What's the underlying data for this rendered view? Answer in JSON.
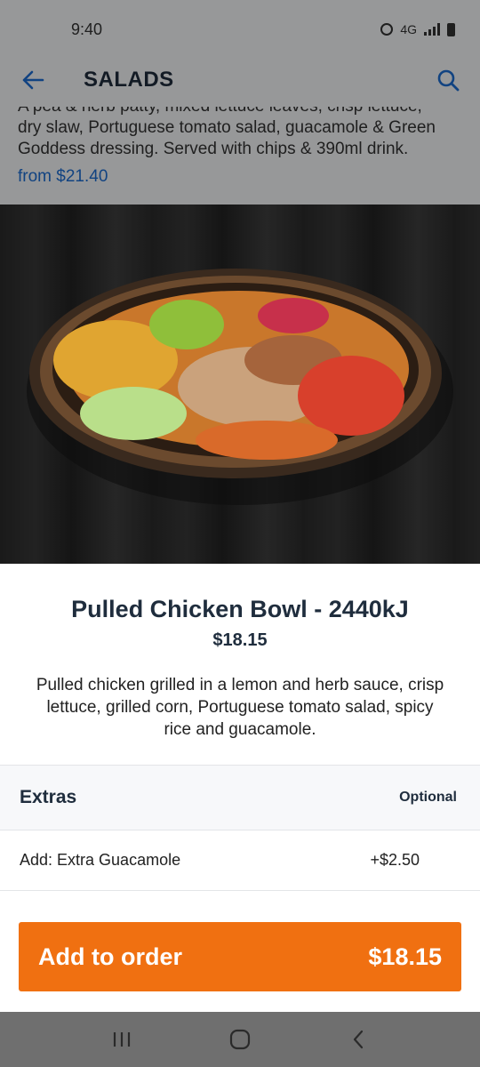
{
  "status_bar": {
    "time": "9:40",
    "network": "4G"
  },
  "app_bar": {
    "title": "SALADS"
  },
  "background_item": {
    "description_lines": [
      "A pea & herb patty, mixed lettuce leaves, crisp lettuce,",
      "dry slaw, Portuguese tomato salad, guacamole & Green",
      "Goddess dressing. Served with chips & 390ml drink."
    ],
    "price": "from $21.40"
  },
  "item": {
    "title": "Pulled Chicken Bowl - 2440kJ",
    "price": "$18.15",
    "description_lines": [
      "Pulled chicken grilled in a lemon and herb sauce, crisp",
      "lettuce, grilled corn, Portuguese tomato salad, spicy",
      "rice and guacamole."
    ]
  },
  "extras": {
    "title": "Extras",
    "optional_label": "Optional",
    "options": [
      {
        "label": "Add: Extra Guacamole",
        "price": "+$2.50"
      }
    ]
  },
  "order_button": {
    "label": "Add to order",
    "price": "$18.15"
  },
  "colors": {
    "accent": "#f07011",
    "link": "#1c6cd1",
    "text": "#1f2d3d"
  },
  "icons": {
    "back": "arrow-left-icon",
    "search": "search-icon",
    "nav_recent": "recent-apps-icon",
    "nav_home": "home-icon",
    "nav_back": "nav-back-icon"
  }
}
